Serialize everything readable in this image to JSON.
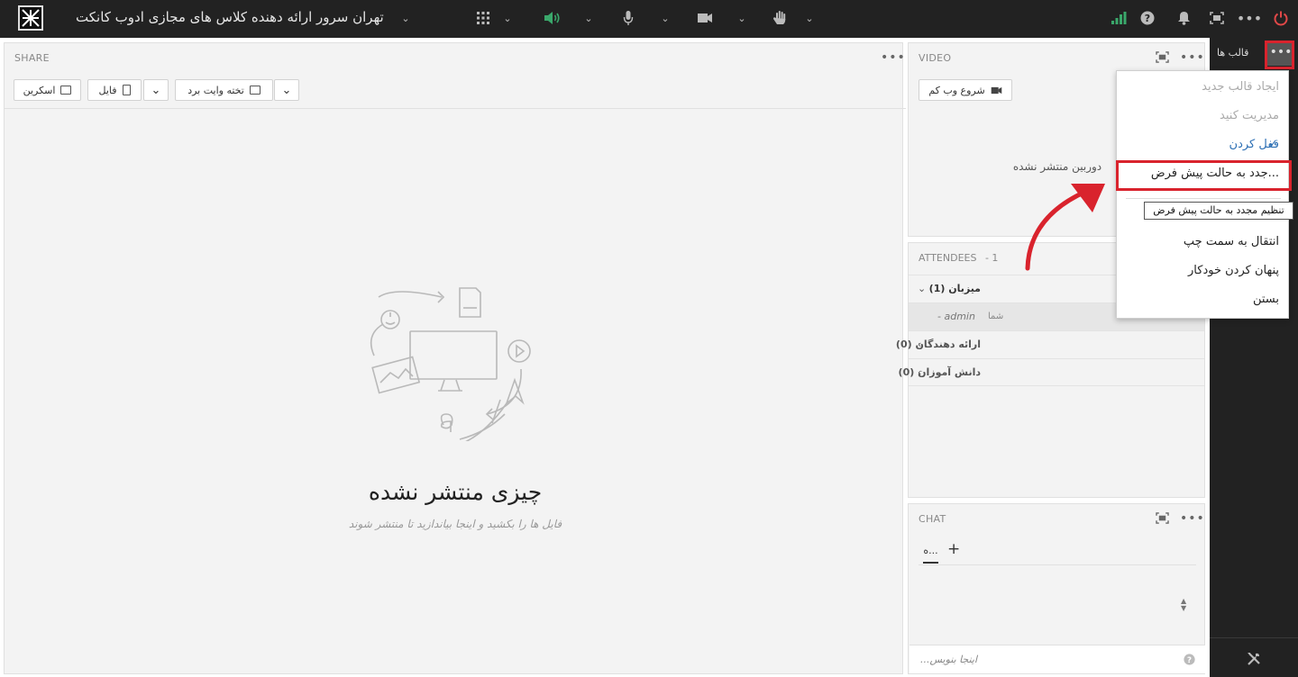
{
  "app": {
    "room_title": "تهران سرور ارائه دهنده کلاس های مجازی ادوب کانکت"
  },
  "share_pod": {
    "title": "SHARE",
    "btn_screen": "اسکرین",
    "btn_file": "فایل",
    "btn_whiteboard": "تخته وایت برد",
    "empty_title": "چیزی منتشر نشده",
    "empty_subtitle": "فایل ها را بکشید و اینجا بیاندازید تا منتشر شوند"
  },
  "video_pod": {
    "title": "VIDEO",
    "start_webcam": "شروع وب کم",
    "no_camera": "دوربین منتشر نشده"
  },
  "attendees_pod": {
    "title": "ATTENDEES",
    "count": "- 1",
    "host_group": "میزبان (1)",
    "host_name": "admin -",
    "host_you": "شما",
    "presenters_group": "ارائه دهندگان (0)",
    "students_group": "دانش آموزان (0)"
  },
  "chat_pod": {
    "title": "CHAT",
    "tab_label": "ه...",
    "add_tab": "+",
    "input_placeholder": "اینجا بنویس..."
  },
  "layouts_panel": {
    "title": "قالب ها"
  },
  "layouts_menu": {
    "items": [
      "ایجاد قالب جدید",
      "مدیریت کنید",
      "قفل کردن",
      "...جدد به حالت پیش فرض",
      "ست",
      "انتقال به سمت چپ",
      "پنهان کردن خودکار",
      "بستن"
    ],
    "tooltip": "تنظیم مجدد به حالت پیش فرض"
  },
  "colors": {
    "topbar": "#222222",
    "pod_background": "#f3f3f3",
    "highlight": "#d9232d",
    "active_item": "#2c6fb4",
    "audio_on": "#3aa86b",
    "signal": "#3aa86b",
    "power": "#e04848"
  },
  "icons": [
    "logo-icon",
    "chevron-down-icon",
    "apps-grid-icon",
    "speaker-icon",
    "microphone-icon",
    "camera-icon",
    "raise-hand-icon",
    "signal-bars-icon",
    "help-icon",
    "bell-icon",
    "fullscreen-icon",
    "more-icon",
    "power-icon",
    "whiteboard-icon",
    "file-icon",
    "screen-icon",
    "webcam-icon",
    "checkmark-icon",
    "settings-tools-icon"
  ]
}
